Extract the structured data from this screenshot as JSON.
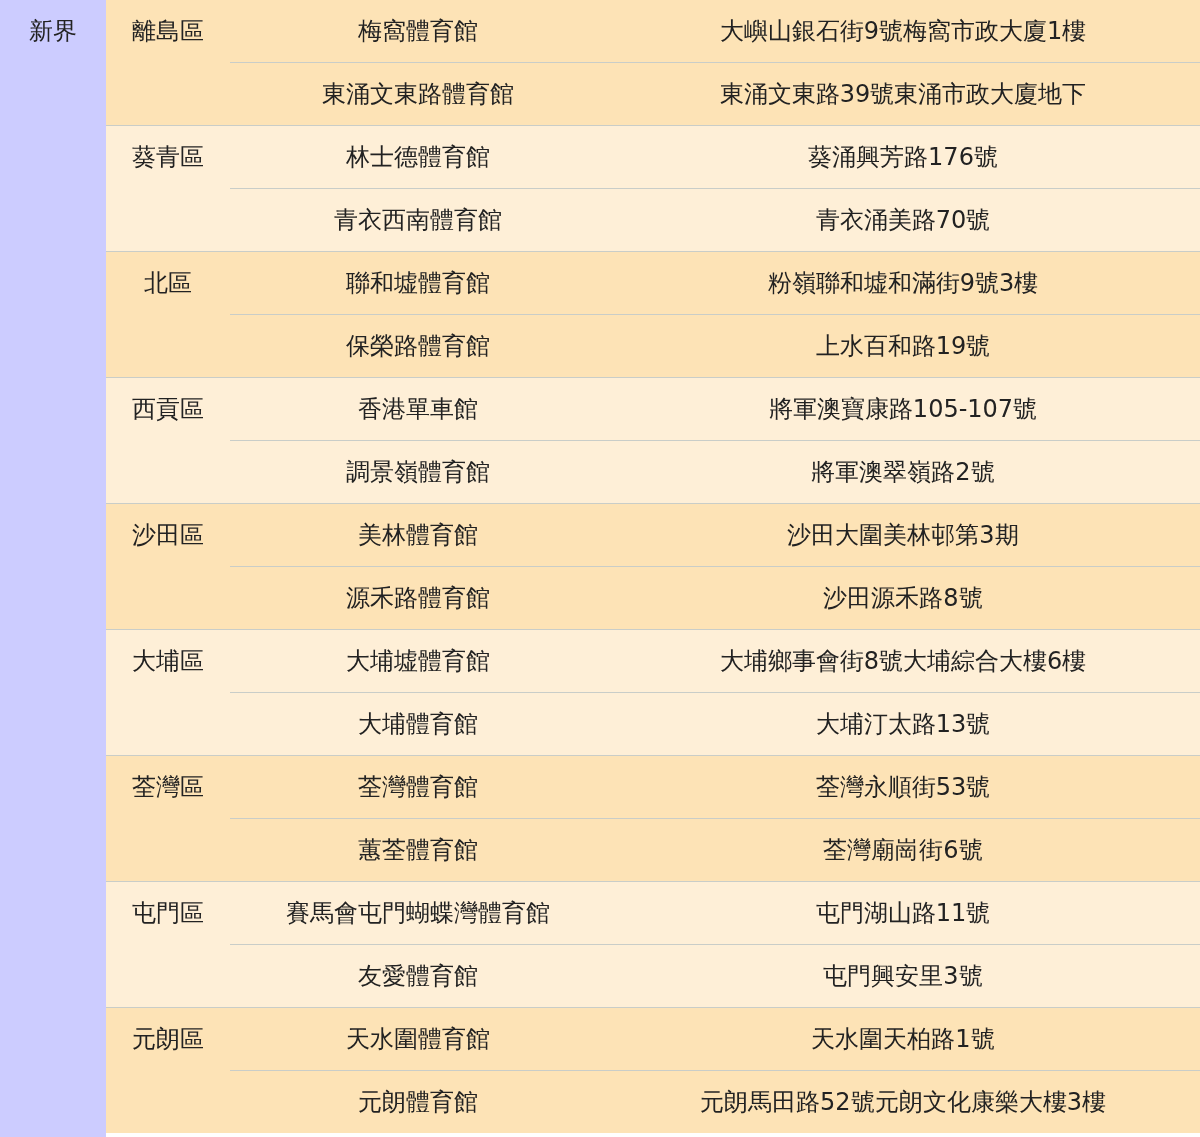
{
  "region": "新界",
  "districts": [
    {
      "name": "離島區",
      "venues": [
        {
          "name": "梅窩體育館",
          "address": "大嶼山銀石街9號梅窩市政大廈1樓"
        },
        {
          "name": "東涌文東路體育館",
          "address": "東涌文東路39號東涌市政大廈地下"
        }
      ]
    },
    {
      "name": "葵青區",
      "venues": [
        {
          "name": "林士德體育館",
          "address": "葵涌興芳路176號"
        },
        {
          "name": "青衣西南體育館",
          "address": "青衣涌美路70號"
        }
      ]
    },
    {
      "name": "北區",
      "venues": [
        {
          "name": "聯和墟體育館",
          "address": "粉嶺聯和墟和滿街9號3樓"
        },
        {
          "name": "保榮路體育館",
          "address": "上水百和路19號"
        }
      ]
    },
    {
      "name": "西貢區",
      "venues": [
        {
          "name": "香港單車館",
          "address": "將軍澳寶康路105-107號"
        },
        {
          "name": "調景嶺體育館",
          "address": "將軍澳翠嶺路2號"
        }
      ]
    },
    {
      "name": "沙田區",
      "venues": [
        {
          "name": "美林體育館",
          "address": "沙田大圍美林邨第3期"
        },
        {
          "name": "源禾路體育館",
          "address": "沙田源禾路8號"
        }
      ]
    },
    {
      "name": "大埔區",
      "venues": [
        {
          "name": "大埔墟體育館",
          "address": "大埔鄉事會街8號大埔綜合大樓6樓"
        },
        {
          "name": "大埔體育館",
          "address": "大埔汀太路13號"
        }
      ]
    },
    {
      "name": "荃灣區",
      "venues": [
        {
          "name": "荃灣體育館",
          "address": "荃灣永順街53號"
        },
        {
          "name": "蕙荃體育館",
          "address": "荃灣廟崗街6號"
        }
      ]
    },
    {
      "name": "屯門區",
      "venues": [
        {
          "name": "賽馬會屯門蝴蝶灣體育館",
          "address": "屯門湖山路11號"
        },
        {
          "name": "友愛體育館",
          "address": "屯門興安里3號"
        }
      ]
    },
    {
      "name": "元朗區",
      "venues": [
        {
          "name": "天水圍體育館",
          "address": "天水圍天柏路1號"
        },
        {
          "name": "元朗體育館",
          "address": "元朗馬田路52號元朗文化康樂大樓3樓"
        }
      ]
    }
  ]
}
